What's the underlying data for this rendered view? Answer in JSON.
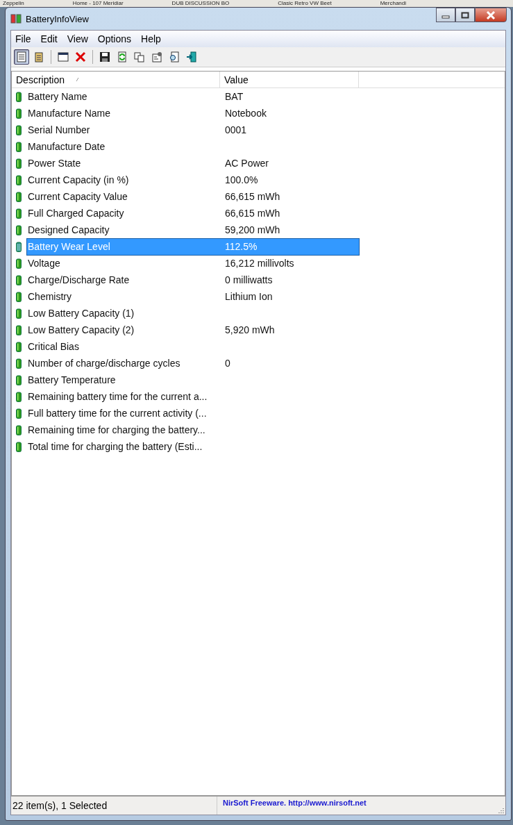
{
  "background_tabs": [
    "Zeppelin",
    "Home - 107 Meridiar",
    "DUB DISCUSSION BO",
    "Clasic Retro VW Beet",
    "Merchandi"
  ],
  "window": {
    "title": "BatteryInfoView"
  },
  "menu": [
    "File",
    "Edit",
    "View",
    "Options",
    "Help"
  ],
  "toolbar": [
    [
      {
        "kind": "view",
        "pressed": true
      },
      {
        "kind": "clipboard",
        "pressed": false
      }
    ],
    [
      {
        "kind": "window",
        "pressed": false
      },
      {
        "kind": "delete",
        "pressed": false
      }
    ],
    [
      {
        "kind": "save",
        "pressed": false
      },
      {
        "kind": "refresh",
        "pressed": false
      },
      {
        "kind": "copy",
        "pressed": false
      },
      {
        "kind": "properties",
        "pressed": false
      },
      {
        "kind": "find",
        "pressed": false
      },
      {
        "kind": "exit",
        "pressed": false
      }
    ]
  ],
  "columns": [
    "Description",
    "Value"
  ],
  "rows": [
    {
      "description": "Battery Name",
      "value": "BAT",
      "selected": false
    },
    {
      "description": "Manufacture Name",
      "value": "Notebook",
      "selected": false
    },
    {
      "description": "Serial Number",
      "value": "0001",
      "selected": false
    },
    {
      "description": "Manufacture Date",
      "value": "",
      "selected": false
    },
    {
      "description": "Power State",
      "value": "AC Power",
      "selected": false
    },
    {
      "description": "Current Capacity (in %)",
      "value": "100.0%",
      "selected": false
    },
    {
      "description": "Current Capacity Value",
      "value": "66,615 mWh",
      "selected": false
    },
    {
      "description": "Full Charged Capacity",
      "value": "66,615 mWh",
      "selected": false
    },
    {
      "description": "Designed Capacity",
      "value": "59,200 mWh",
      "selected": false
    },
    {
      "description": "Battery Wear Level",
      "value": "112.5%",
      "selected": true
    },
    {
      "description": "Voltage",
      "value": "16,212 millivolts",
      "selected": false
    },
    {
      "description": "Charge/Discharge Rate",
      "value": "0 milliwatts",
      "selected": false
    },
    {
      "description": "Chemistry",
      "value": "Lithium Ion",
      "selected": false
    },
    {
      "description": "Low Battery Capacity (1)",
      "value": "",
      "selected": false
    },
    {
      "description": "Low Battery Capacity (2)",
      "value": "5,920 mWh",
      "selected": false
    },
    {
      "description": "Critical Bias",
      "value": "",
      "selected": false
    },
    {
      "description": "Number of charge/discharge cycles",
      "value": "0",
      "selected": false
    },
    {
      "description": "Battery Temperature",
      "value": "",
      "selected": false
    },
    {
      "description": "Remaining battery time for the current a...",
      "value": "",
      "selected": false
    },
    {
      "description": "Full battery time for the current activity (...",
      "value": "",
      "selected": false
    },
    {
      "description": "Remaining time for charging the battery...",
      "value": "",
      "selected": false
    },
    {
      "description": "Total  time for charging the battery (Esti...",
      "value": "",
      "selected": false
    }
  ],
  "status_bar": {
    "count": "22 item(s), 1 Selected",
    "credit": "NirSoft Freeware.  http://www.nirsoft.net"
  }
}
